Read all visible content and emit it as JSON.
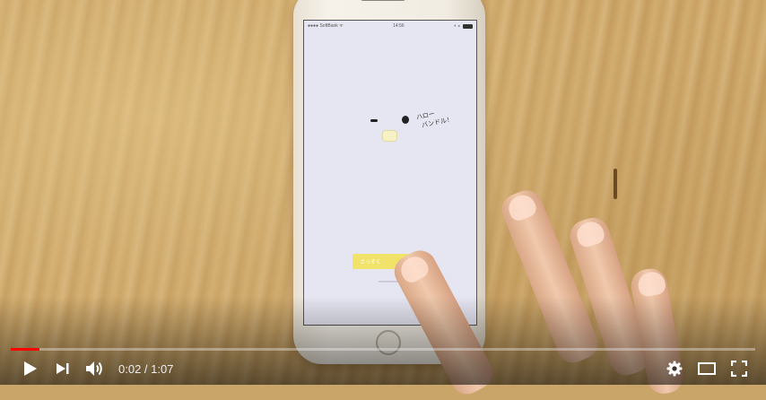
{
  "video": {
    "status_bar": {
      "carrier": "●●●● SoftBank ᯤ",
      "time": "14:56",
      "right": "◐ ⁎"
    },
    "app": {
      "greeting_line1": "ハロー",
      "greeting_line2": "バンドル！",
      "start_button_label": "さっそく"
    }
  },
  "player": {
    "current_time": "0:02",
    "separator": " / ",
    "duration": "1:07",
    "progress_fraction": 0.039,
    "loaded_fraction": 0.039,
    "icons": {
      "play": "play-icon",
      "next": "next-icon",
      "volume": "volume-icon",
      "settings": "gear-icon",
      "theater": "theater-mode-icon",
      "fullscreen": "fullscreen-icon"
    },
    "colors": {
      "progress": "#ff0000",
      "icon": "#ffffff"
    }
  }
}
